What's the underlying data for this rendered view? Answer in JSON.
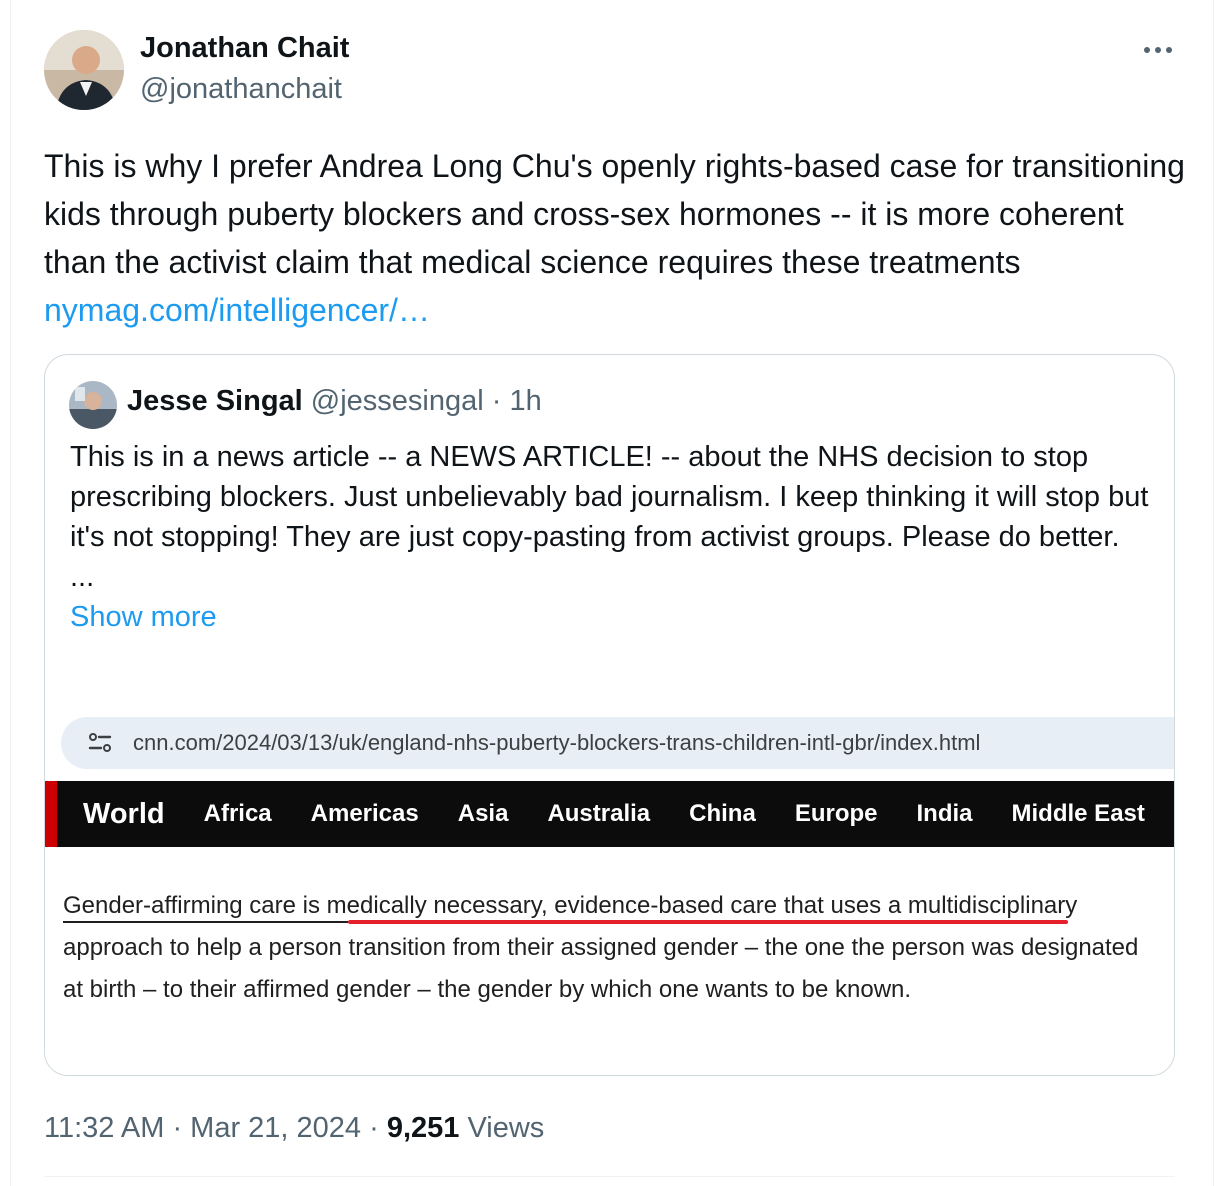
{
  "author": {
    "name": "Jonathan Chait",
    "handle": "@jonathanchait"
  },
  "tweet": {
    "text": "This is why I prefer Andrea Long Chu's openly rights-based case for transitioning kids through puberty blockers and cross-sex hormones -- it is more coherent than the activist claim that medical science requires these treatments ",
    "link_text": "nymag.com/intelligencer/…"
  },
  "quoted_tweet": {
    "name": "Jesse Singal",
    "handle": "@jessesingal",
    "separator": " · ",
    "time": "1h",
    "text": "This is in a news article -- a NEWS ARTICLE! -- about the NHS decision to stop prescribing blockers. Just unbelievably bad journalism. I keep thinking it will stop but it's not stopping! They are just copy-pasting from activist groups. Please do better.",
    "ellipsis": "...",
    "show_more": "Show more"
  },
  "embedded_screenshot": {
    "url": "cnn.com/2024/03/13/uk/england-nhs-puberty-blockers-trans-children-intl-gbr/index.html",
    "nav": [
      "World",
      "Africa",
      "Americas",
      "Asia",
      "Australia",
      "China",
      "Europe",
      "India",
      "Middle East"
    ],
    "article_line1_a": "Gender-affirming care",
    "article_line1_b": " is medically necessary, evidence-based care that uses a",
    "article_rest": "multidisciplinary approach to help a person transition from their assigned gender – the one the person was designated at birth – to their affirmed gender – the gender by which one wants to be known."
  },
  "footer": {
    "time": "11:32 AM",
    "separator": " · ",
    "date": "Mar 21, 2024",
    "views_count": "9,251",
    "views_label": " Views"
  },
  "colors": {
    "link": "#1d9bf0",
    "secondary_text": "#536471",
    "underline": "#e5202b",
    "nav_background": "#0c0c0c",
    "nav_accent": "#cc0000"
  },
  "icons": {
    "more": "more-dots-icon",
    "site_info": "site-info-icon"
  }
}
